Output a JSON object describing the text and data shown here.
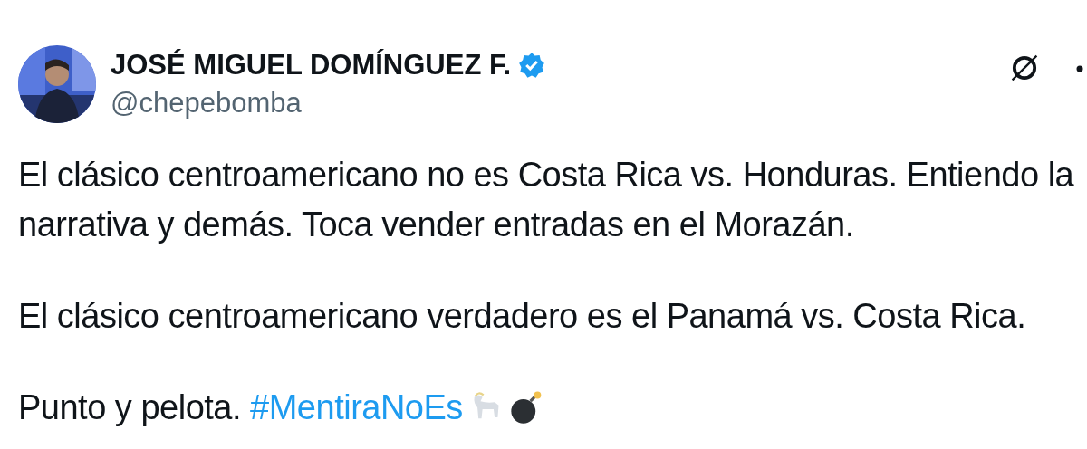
{
  "author": {
    "name": "JOSÉ MIGUEL DOMÍNGUEZ F.",
    "verified": true,
    "handle": "@chepebomba"
  },
  "paragraphs": [
    {
      "text": "El clásico centroamericano no es Costa Rica vs. Honduras. Entiendo la narrativa y demás. Toca vender entradas en el Morazán."
    },
    {
      "text": "El clásico centroamericano verdadero es el Panamá vs. Costa Rica."
    },
    {
      "text": "Punto y pelota. ",
      "hashtag": "#MentiraNoEs"
    }
  ]
}
